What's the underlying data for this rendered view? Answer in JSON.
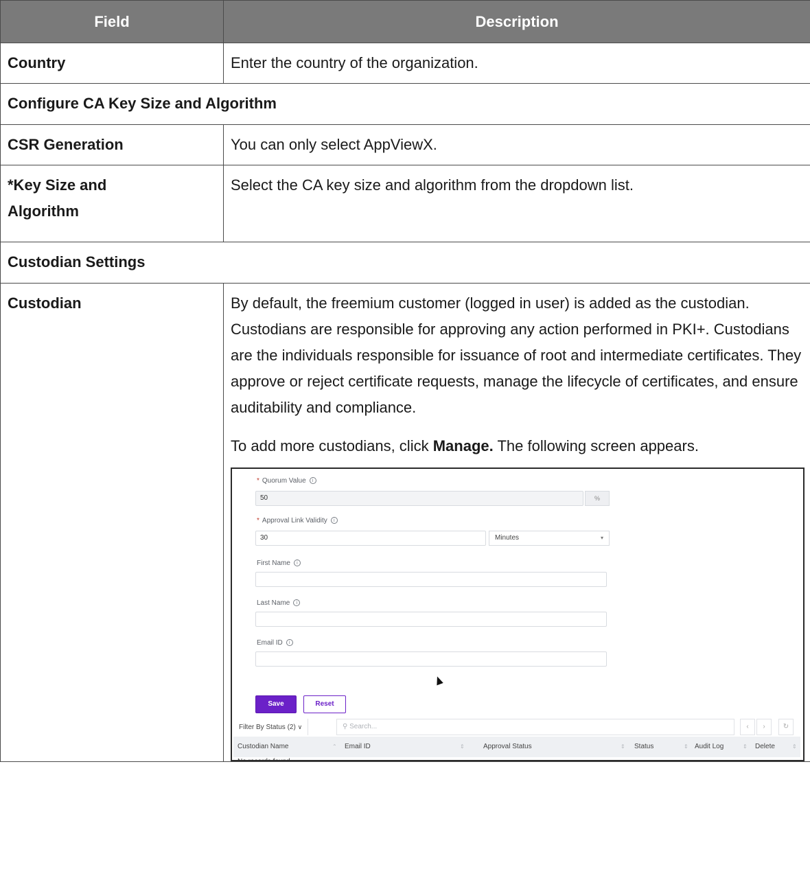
{
  "table": {
    "headers": {
      "field": "Field",
      "description": "Description"
    },
    "rows": {
      "country": {
        "field": "Country",
        "description": "Enter the country of the organization."
      },
      "section_key": "Configure CA Key Size and Algorithm",
      "csr": {
        "field": "CSR Generation",
        "description": "You can only select AppViewX."
      },
      "keysize": {
        "field_line1": "*Key Size and",
        "field_line2": "Algorithm",
        "description": "Select the CA key size and algorithm from the dropdown list."
      },
      "section_custodian": "Custodian Settings",
      "custodian": {
        "field": "Custodian",
        "description_p1": "By default, the freemium customer (logged in user) is added as the custodian. Custodians are responsible for approving any action performed in PKI+. Custodians are the individuals responsible for issuance of root and intermediate certificates. They approve or reject certificate requests, manage the lifecycle of certificates, and ensure auditability and compliance.",
        "description_p2_pre": "To add more custodians, click ",
        "description_p2_bold": "Manage.",
        "description_p2_post": " The following screen appears."
      }
    }
  },
  "screenshot": {
    "quorum_label": "Quorum Value",
    "quorum_value": "50",
    "quorum_suffix": "%",
    "approval_label": "Approval Link Validity",
    "approval_value": "30",
    "approval_unit": "Minutes",
    "first_name_label": "First Name",
    "last_name_label": "Last Name",
    "email_label": "Email ID",
    "save_label": "Save",
    "reset_label": "Reset",
    "filter_label": "Filter By Status (2)",
    "search_placeholder": "Search...",
    "columns": [
      "Custodian Name",
      "Email ID",
      "Approval Status",
      "Status",
      "Audit Log",
      "Delete"
    ],
    "empty_text": "No records found"
  }
}
